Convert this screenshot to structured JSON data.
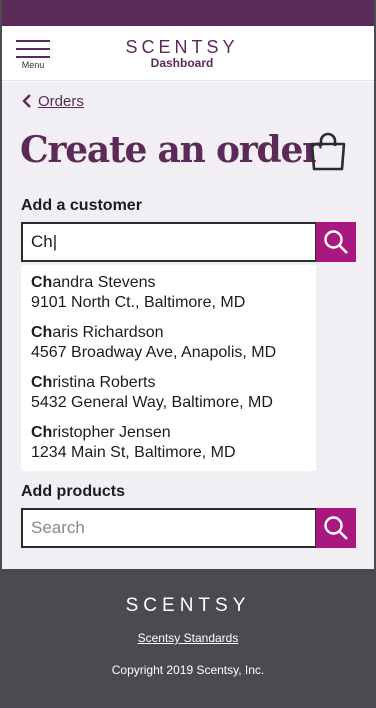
{
  "header": {
    "menu_label": "Menu",
    "brand_name": "SCENTSY",
    "brand_sub": "Dashboard"
  },
  "breadcrumb": {
    "label": "Orders"
  },
  "page": {
    "title": "Create an order"
  },
  "customer_section": {
    "label": "Add a customer",
    "query": "Ch|",
    "suggestions": [
      {
        "match": "Ch",
        "rest": "andra Stevens",
        "address": "9101 North Ct., Baltimore, MD"
      },
      {
        "match": "Ch",
        "rest": "aris Richardson",
        "address": "4567 Broadway Ave, Anapolis, MD"
      },
      {
        "match": "Ch",
        "rest": "ristina Roberts",
        "address": "5432 General Way, Baltimore, MD"
      },
      {
        "match": "Ch",
        "rest": "ristopher Jensen",
        "address": "1234 Main St, Baltimore, MD"
      }
    ]
  },
  "products_section": {
    "label": "Add products",
    "placeholder": "Search"
  },
  "footer": {
    "brand": "SCENTSY",
    "standards_link": "Scentsy Standards",
    "copyright": "Copyright 2019 Scentsy, Inc."
  },
  "colors": {
    "brand_purple": "#5c2a58",
    "accent_magenta": "#a8197f",
    "page_bg": "#f1eff3",
    "footer_bg": "#4d4951"
  }
}
